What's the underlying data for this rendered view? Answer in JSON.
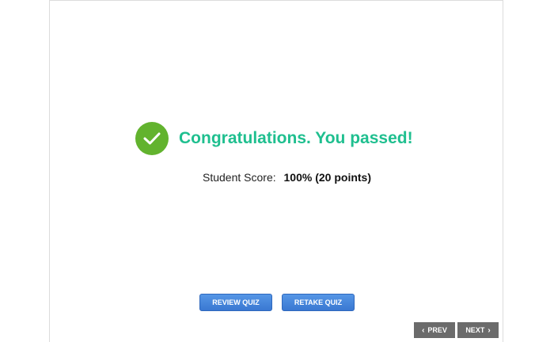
{
  "result": {
    "headline": "Congratulations. You passed!",
    "score_label": "Student Score:",
    "score_value": "100% (20 points)"
  },
  "buttons": {
    "review_label": "REVIEW QUIZ",
    "retake_label": "RETAKE QUIZ"
  },
  "nav": {
    "prev_label": "PREV",
    "next_label": "NEXT",
    "prev_icon": "chevron-left-icon",
    "next_icon": "chevron-right-icon"
  },
  "colors": {
    "success_green": "#62b32e",
    "headline_teal": "#1fbf8f",
    "button_blue": "#3a78d2",
    "nav_gray": "#6b6b6b"
  }
}
